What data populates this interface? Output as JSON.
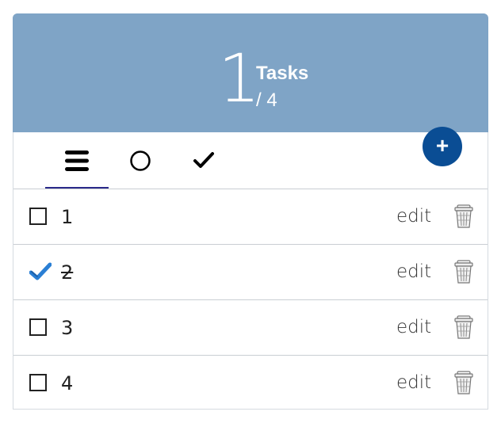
{
  "header": {
    "remaining_count": "1",
    "title": "Tasks",
    "total": "/ 4",
    "add_button_label": "+"
  },
  "tabs": [
    {
      "name": "all",
      "icon": "list-icon",
      "active": true
    },
    {
      "name": "active",
      "icon": "circle-icon",
      "active": false
    },
    {
      "name": "completed",
      "icon": "checkmark-icon",
      "active": false
    }
  ],
  "tasks": [
    {
      "label": "1",
      "done": false,
      "edit_label": "edit"
    },
    {
      "label": "2",
      "done": true,
      "edit_label": "edit"
    },
    {
      "label": "3",
      "done": false,
      "edit_label": "edit"
    },
    {
      "label": "4",
      "done": false,
      "edit_label": "edit"
    }
  ],
  "colors": {
    "header_bg": "#7fa4c6",
    "add_button_bg": "#0a4d94",
    "check_blue": "#2a7fd4",
    "tab_underline": "#2a2a8a"
  }
}
